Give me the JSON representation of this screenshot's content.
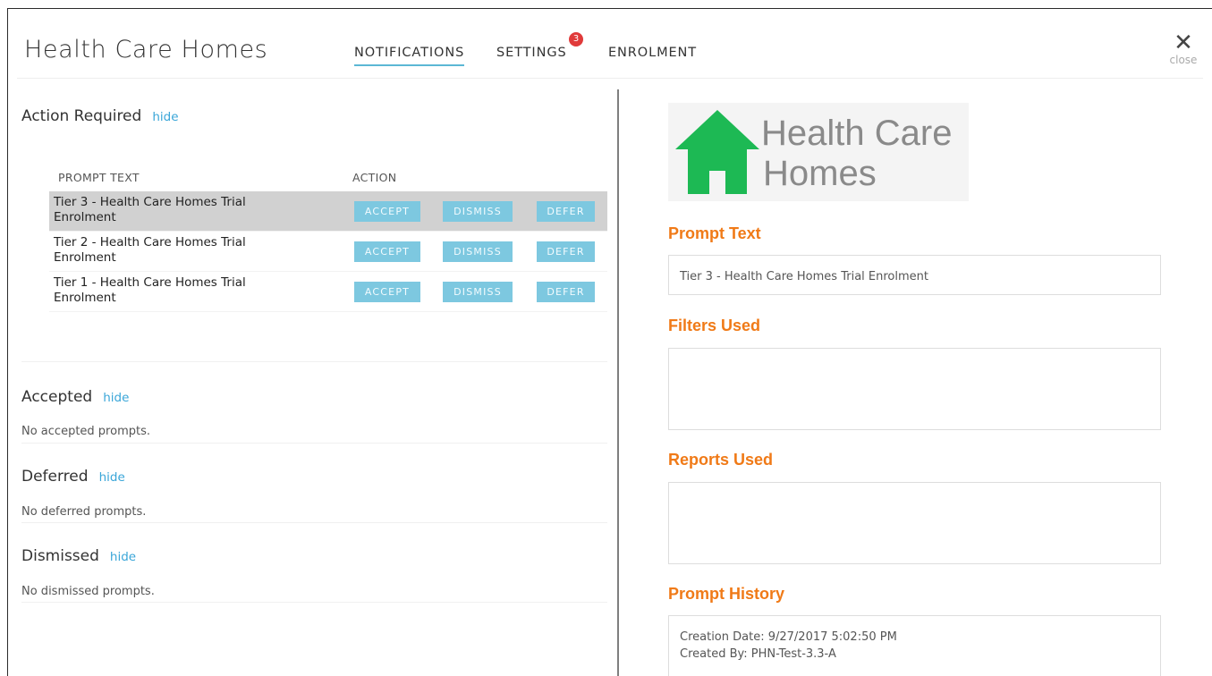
{
  "header": {
    "title": "Health Care Homes",
    "tabs": [
      {
        "label": "NOTIFICATIONS",
        "active": true
      },
      {
        "label": "SETTINGS",
        "badge": "3"
      },
      {
        "label": "ENROLMENT"
      }
    ],
    "close_icon": "close-x-icon",
    "close_label": "close"
  },
  "action_required": {
    "title": "Action Required",
    "hide_label": "hide",
    "columns": [
      "PROMPT TEXT",
      "ACTION"
    ],
    "rows": [
      {
        "line1": "Tier 3 - Health Care Homes Trial",
        "line2": "Enrolment",
        "selected": true
      },
      {
        "line1": "Tier 2 - Health Care Homes Trial",
        "line2": "Enrolment",
        "selected": false
      },
      {
        "line1": "Tier 1 - Health Care Homes Trial",
        "line2": "Enrolment",
        "selected": false
      }
    ],
    "buttons": {
      "accept": "ACCEPT",
      "dismiss": "DISMISS",
      "defer": "DEFER"
    }
  },
  "accepted": {
    "title": "Accepted",
    "hide_label": "hide",
    "empty": "No accepted prompts."
  },
  "deferred": {
    "title": "Deferred",
    "hide_label": "hide",
    "empty": "No deferred prompts."
  },
  "dismissed": {
    "title": "Dismissed",
    "hide_label": "hide",
    "empty": "No dismissed prompts."
  },
  "detail": {
    "logo": {
      "line1": "Health Care",
      "line2": "Homes",
      "icon": "house-icon",
      "color": "#1db954"
    },
    "prompt_text_label": "Prompt Text",
    "prompt_text_value": "Tier 3 - Health Care Homes Trial Enrolment",
    "filters_label": "Filters Used",
    "filters_value": "",
    "reports_label": "Reports Used",
    "reports_value": "",
    "history_label": "Prompt History",
    "history_created_date": "Creation Date: 9/27/2017 5:02:50 PM",
    "history_created_by": "Created By: PHN-Test-3.3-A"
  },
  "colors": {
    "accent": "#5bb7d5",
    "button": "#7dc8e0",
    "label_orange": "#f07a17",
    "badge": "#e03a3a"
  }
}
